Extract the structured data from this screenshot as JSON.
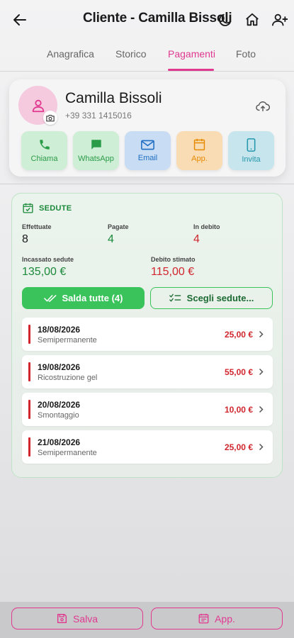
{
  "header": {
    "title": "Cliente - Camilla Bissoli"
  },
  "tabs": [
    {
      "label": "Anagrafica"
    },
    {
      "label": "Storico"
    },
    {
      "label": "Pagamenti"
    },
    {
      "label": "Foto"
    }
  ],
  "active_tab": "Pagamenti",
  "client": {
    "name": "Camilla Bissoli",
    "phone": "+39 331 1415016"
  },
  "actions": [
    {
      "label": "Chiama",
      "icon": "phone-icon",
      "color": "#2a9b47",
      "bg": "#cfeed6"
    },
    {
      "label": "WhatsApp",
      "icon": "chat-icon",
      "color": "#2a9b47",
      "bg": "#cfeed6"
    },
    {
      "label": "Email",
      "icon": "email-icon",
      "color": "#1f6fc4",
      "bg": "#c8dcf3"
    },
    {
      "label": "App.",
      "icon": "calendar-icon",
      "color": "#e68a00",
      "bg": "#f9dcb4"
    },
    {
      "label": "Invita",
      "icon": "mobile-icon",
      "color": "#2597ad",
      "bg": "#c7e5ec"
    }
  ],
  "sedute": {
    "title": "SEDUTE",
    "effettuate_label": "Effettuate",
    "effettuate": "8",
    "pagate_label": "Pagate",
    "pagate": "4",
    "debito_label": "In debito",
    "debito": "4",
    "incassato_label": "Incassato sedute",
    "incassato": "135,00 €",
    "stimato_label": "Debito stimato",
    "stimato": "115,00 €",
    "saldo_button": "Salda tutte (4)",
    "scegli_button": "Scegli sedute...",
    "items": [
      {
        "date": "18/08/2026",
        "treatment": "Semipermanente",
        "amount": "25,00 €"
      },
      {
        "date": "19/08/2026",
        "treatment": "Ricostruzione gel",
        "amount": "55,00 €"
      },
      {
        "date": "20/08/2026",
        "treatment": "Smontaggio",
        "amount": "10,00 €"
      },
      {
        "date": "21/08/2026",
        "treatment": "Semipermanente",
        "amount": "25,00 €"
      }
    ]
  },
  "bottom": {
    "save_label": "Salva",
    "app_label": "App."
  },
  "colors": {
    "accent": "#e0398f",
    "green": "#3ac35b",
    "red": "#d1262e"
  }
}
